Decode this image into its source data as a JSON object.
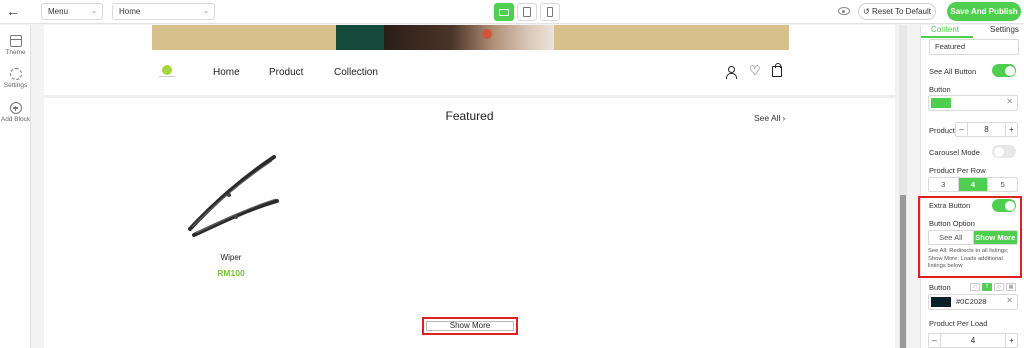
{
  "topbar": {
    "menu_select": "Menu",
    "page_select": "Home",
    "reset_label": "Reset To Default",
    "publish_label": "Save And Publish",
    "devices": [
      "desktop",
      "tablet",
      "mobile"
    ],
    "active_device": "desktop"
  },
  "leftbar": {
    "items": [
      {
        "label": "Theme",
        "icon": "theme-icon"
      },
      {
        "label": "Settings",
        "icon": "gear-icon"
      },
      {
        "label": "Add Block",
        "icon": "plus-circle-icon"
      }
    ]
  },
  "store": {
    "nav": [
      "Home",
      "Product",
      "Collection"
    ],
    "section_title": "Featured",
    "see_all": "See All",
    "products": [
      {
        "name": "Wiper",
        "price": "RM100"
      }
    ],
    "show_more_label": "Show More"
  },
  "panel": {
    "tabs": [
      "Content",
      "Settings"
    ],
    "active_tab": "Content",
    "title_value": "Featured",
    "see_all_button_label": "See All Button",
    "see_all_button_on": true,
    "button_label": "Button",
    "button_color": "#4fcf4f",
    "product_label": "Product",
    "product_value": "8",
    "carousel_label": "Carousel Mode",
    "carousel_on": false,
    "per_row_label": "Product Per Row",
    "per_row_options": [
      "3",
      "4",
      "5"
    ],
    "per_row_selected": "4",
    "extra_button_label": "Extra Button",
    "extra_button_on": true,
    "button_option_label": "Button Option",
    "button_options": [
      "See All",
      "Show More"
    ],
    "button_option_selected": "Show More",
    "help_text": "See All: Redirects to all listings; Show More: Loads additional listings below",
    "button2_label": "Button",
    "button2_color_value": "#0C2028",
    "per_load_label": "Product Per Load",
    "per_load_value": "4"
  },
  "colors": {
    "accent": "#4fcf4f",
    "price": "#7cc53a",
    "highlight": "#e02020"
  }
}
